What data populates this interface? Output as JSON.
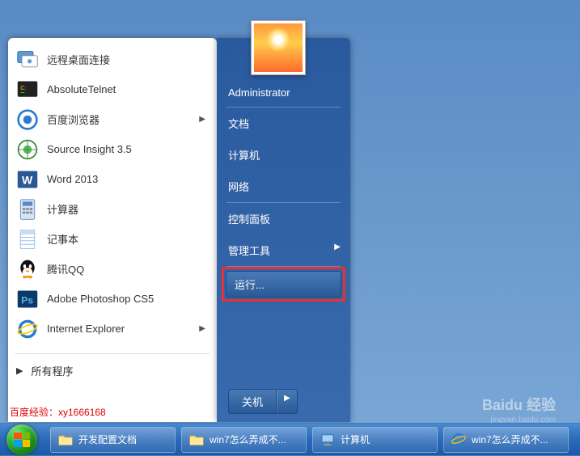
{
  "left_programs": [
    {
      "label": "远程桌面连接",
      "icon": "rdp",
      "has_sub": false
    },
    {
      "label": "AbsoluteTelnet",
      "icon": "telnet",
      "has_sub": false
    },
    {
      "label": "百度浏览器",
      "icon": "baidu",
      "has_sub": true
    },
    {
      "label": "Source Insight 3.5",
      "icon": "source-insight",
      "has_sub": false
    },
    {
      "label": "Word 2013",
      "icon": "word",
      "has_sub": false
    },
    {
      "label": "计算器",
      "icon": "calculator",
      "has_sub": false
    },
    {
      "label": "记事本",
      "icon": "notepad",
      "has_sub": false
    },
    {
      "label": "腾讯QQ",
      "icon": "qq",
      "has_sub": false
    },
    {
      "label": "Adobe Photoshop CS5",
      "icon": "photoshop",
      "has_sub": false
    },
    {
      "label": "Internet Explorer",
      "icon": "ie",
      "has_sub": true
    }
  ],
  "all_programs_label": "所有程序",
  "right_items": [
    {
      "label": "Administrator",
      "has_sub": false
    },
    {
      "label": "文档",
      "has_sub": false
    },
    {
      "label": "计算机",
      "has_sub": false
    },
    {
      "label": "网络",
      "has_sub": false
    },
    {
      "label": "控制面板",
      "has_sub": false
    },
    {
      "label": "管理工具",
      "has_sub": true
    }
  ],
  "run_label": "运行...",
  "shutdown_label": "关机",
  "watermark_left": "百度经验：xy1666168",
  "watermark_right": "Baidu 经验",
  "watermark_url": "jingyan.baidu.com",
  "taskbar": [
    {
      "label": "开发配置文档",
      "icon": "folder"
    },
    {
      "label": "win7怎么弄成不...",
      "icon": "folder"
    },
    {
      "label": "计算机",
      "icon": "computer"
    },
    {
      "label": "win7怎么弄成不...",
      "icon": "ie"
    }
  ]
}
